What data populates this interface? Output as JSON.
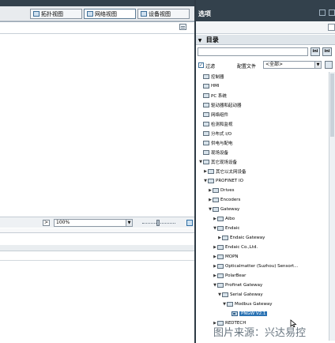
{
  "tabs": [
    {
      "label": "拓扑视图",
      "active": false
    },
    {
      "label": "网络视图",
      "active": true
    },
    {
      "label": "设备视图",
      "active": false
    }
  ],
  "zoom": {
    "value": "100%",
    "prev_btn": ">"
  },
  "options_title": "选项",
  "catalog": {
    "title": "目录",
    "search_placeholder": "",
    "search_btn1": "ini",
    "search_btn2": "ini",
    "filter_label": "过滤",
    "profile_label": "配置文件",
    "profile_value": "<全部>"
  },
  "tree": [
    {
      "label": "控制器",
      "indent": 0,
      "twisty": "",
      "type": "folder"
    },
    {
      "label": "HMI",
      "indent": 0,
      "twisty": "",
      "type": "folder"
    },
    {
      "label": "PC 系统",
      "indent": 0,
      "twisty": "",
      "type": "folder"
    },
    {
      "label": "驱动器和起动器",
      "indent": 0,
      "twisty": "",
      "type": "folder"
    },
    {
      "label": "网络组件",
      "indent": 0,
      "twisty": "",
      "type": "folder"
    },
    {
      "label": "检测和监视",
      "indent": 0,
      "twisty": "",
      "type": "folder"
    },
    {
      "label": "分布式 I/O",
      "indent": 0,
      "twisty": "",
      "type": "folder"
    },
    {
      "label": "供电与配电",
      "indent": 0,
      "twisty": "",
      "type": "folder"
    },
    {
      "label": "现场设备",
      "indent": 0,
      "twisty": "",
      "type": "folder"
    },
    {
      "label": "其它现场设备",
      "indent": 0,
      "twisty": "▼",
      "type": "folder"
    },
    {
      "label": "其它以太网设备",
      "indent": 1,
      "twisty": "▶",
      "type": "folder"
    },
    {
      "label": "PROFINET IO",
      "indent": 1,
      "twisty": "▼",
      "type": "folder"
    },
    {
      "label": "Drives",
      "indent": 2,
      "twisty": "▶",
      "type": "folder"
    },
    {
      "label": "Encoders",
      "indent": 2,
      "twisty": "▶",
      "type": "folder"
    },
    {
      "label": "Gateway",
      "indent": 2,
      "twisty": "▼",
      "type": "folder"
    },
    {
      "label": "Aibo",
      "indent": 3,
      "twisty": "▶",
      "type": "folder"
    },
    {
      "label": "Endaic",
      "indent": 3,
      "twisty": "▼",
      "type": "folder"
    },
    {
      "label": "Endaic Gateway",
      "indent": 4,
      "twisty": "▶",
      "type": "folder"
    },
    {
      "label": "Endaic Co.,Ltd.",
      "indent": 3,
      "twisty": "▶",
      "type": "folder"
    },
    {
      "label": "MOPN",
      "indent": 3,
      "twisty": "▶",
      "type": "folder"
    },
    {
      "label": "Opticalmatter (Suzhou) Sensort...",
      "indent": 3,
      "twisty": "▶",
      "type": "folder"
    },
    {
      "label": "PolarBear",
      "indent": 3,
      "twisty": "▶",
      "type": "folder"
    },
    {
      "label": "Profinet Gateway",
      "indent": 3,
      "twisty": "▼",
      "type": "folder"
    },
    {
      "label": "Serial Gateway",
      "indent": 4,
      "twisty": "▼",
      "type": "folder"
    },
    {
      "label": "Modbus Gateway",
      "indent": 5,
      "twisty": "▼",
      "type": "folder"
    },
    {
      "label": "PNGW V2.1",
      "indent": 6,
      "twisty": "",
      "type": "device",
      "selected": true
    },
    {
      "label": "REDTECH",
      "indent": 3,
      "twisty": "▶",
      "type": "folder"
    }
  ],
  "watermark": "图片来源：兴达易控"
}
